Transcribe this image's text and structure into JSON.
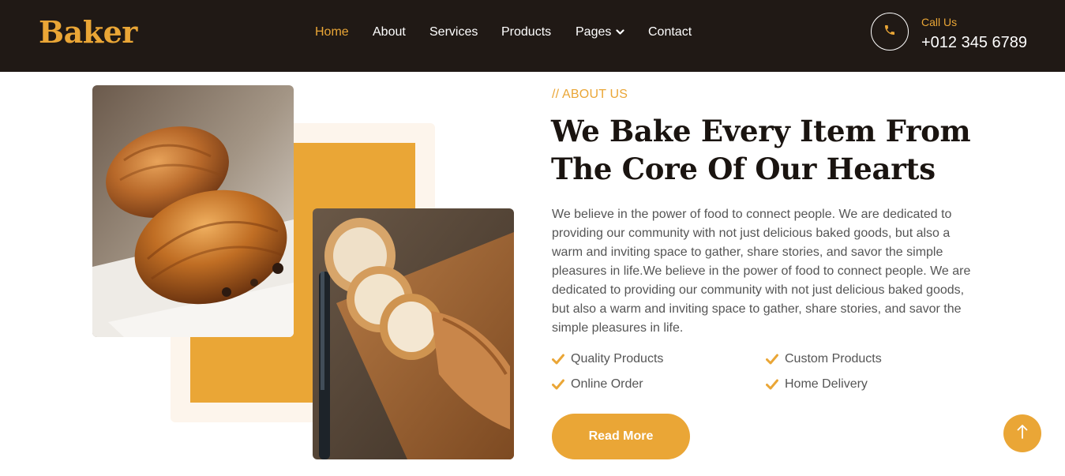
{
  "brand": {
    "name": "Baker",
    "color": "#eaa636"
  },
  "nav": {
    "items": [
      {
        "label": "Home",
        "active": true
      },
      {
        "label": "About"
      },
      {
        "label": "Services"
      },
      {
        "label": "Products"
      },
      {
        "label": "Pages",
        "has_dropdown": true
      },
      {
        "label": "Contact"
      }
    ]
  },
  "call": {
    "label": "Call Us",
    "number": "+012 345 6789",
    "icon": "phone-icon"
  },
  "about": {
    "eyebrow": "// ABOUT US",
    "heading_line1": "We Bake Every Item From",
    "heading_line2": "The Core Of Our Hearts",
    "description": "We believe in the power of food to connect people. We are dedicated to providing our community with not just delicious baked goods, but also a warm and inviting space to gather, share stories, and savor the simple pleasures in life.We believe in the power of food to connect people. We are dedicated to providing our community with not just delicious baked goods, but also a warm and inviting space to gather, share stories, and savor the simple pleasures in life.",
    "features": [
      "Quality Products",
      "Custom Products",
      "Online Order",
      "Home Delivery"
    ],
    "cta": "Read More"
  },
  "images": {
    "first": "croissant-photo",
    "second": "baguette-photo"
  },
  "back_to_top_icon": "arrow-up-icon",
  "colors": {
    "accent": "#eaa636",
    "dark": "#201915",
    "beige": "#fdf5ec"
  }
}
